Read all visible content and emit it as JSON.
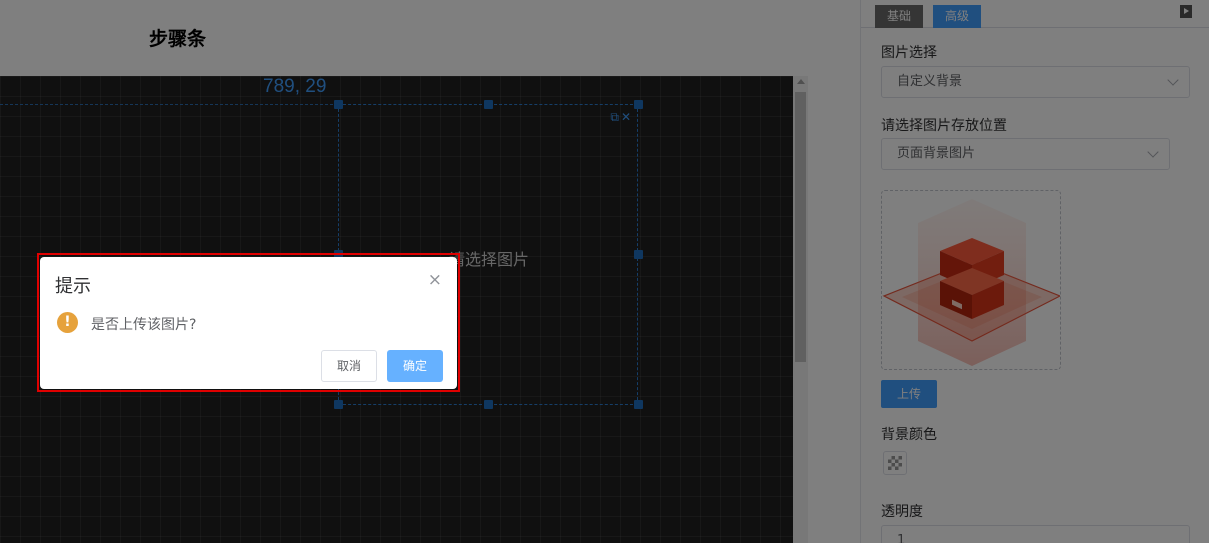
{
  "header": {
    "title": "步骤条"
  },
  "canvas": {
    "coordinates": "789, 29",
    "placeholder": "请选择图片",
    "tools": "⧉✕"
  },
  "panel": {
    "tabs": [
      "基础",
      "高级"
    ],
    "image_select_label": "图片选择",
    "image_select_value": "自定义背景",
    "location_label": "请选择图片存放位置",
    "location_value": "页面背景图片",
    "upload_label": "上传",
    "bg_color_label": "背景颜色",
    "opacity_label": "透明度",
    "opacity_value": "1"
  },
  "dialog": {
    "title": "提示",
    "close": "×",
    "icon": "!",
    "message": "是否上传该图片?",
    "cancel": "取消",
    "confirm": "确定"
  },
  "colors": {
    "accent": "#409eff",
    "warning": "#e6a23c",
    "highlight_frame": "#e00000"
  }
}
